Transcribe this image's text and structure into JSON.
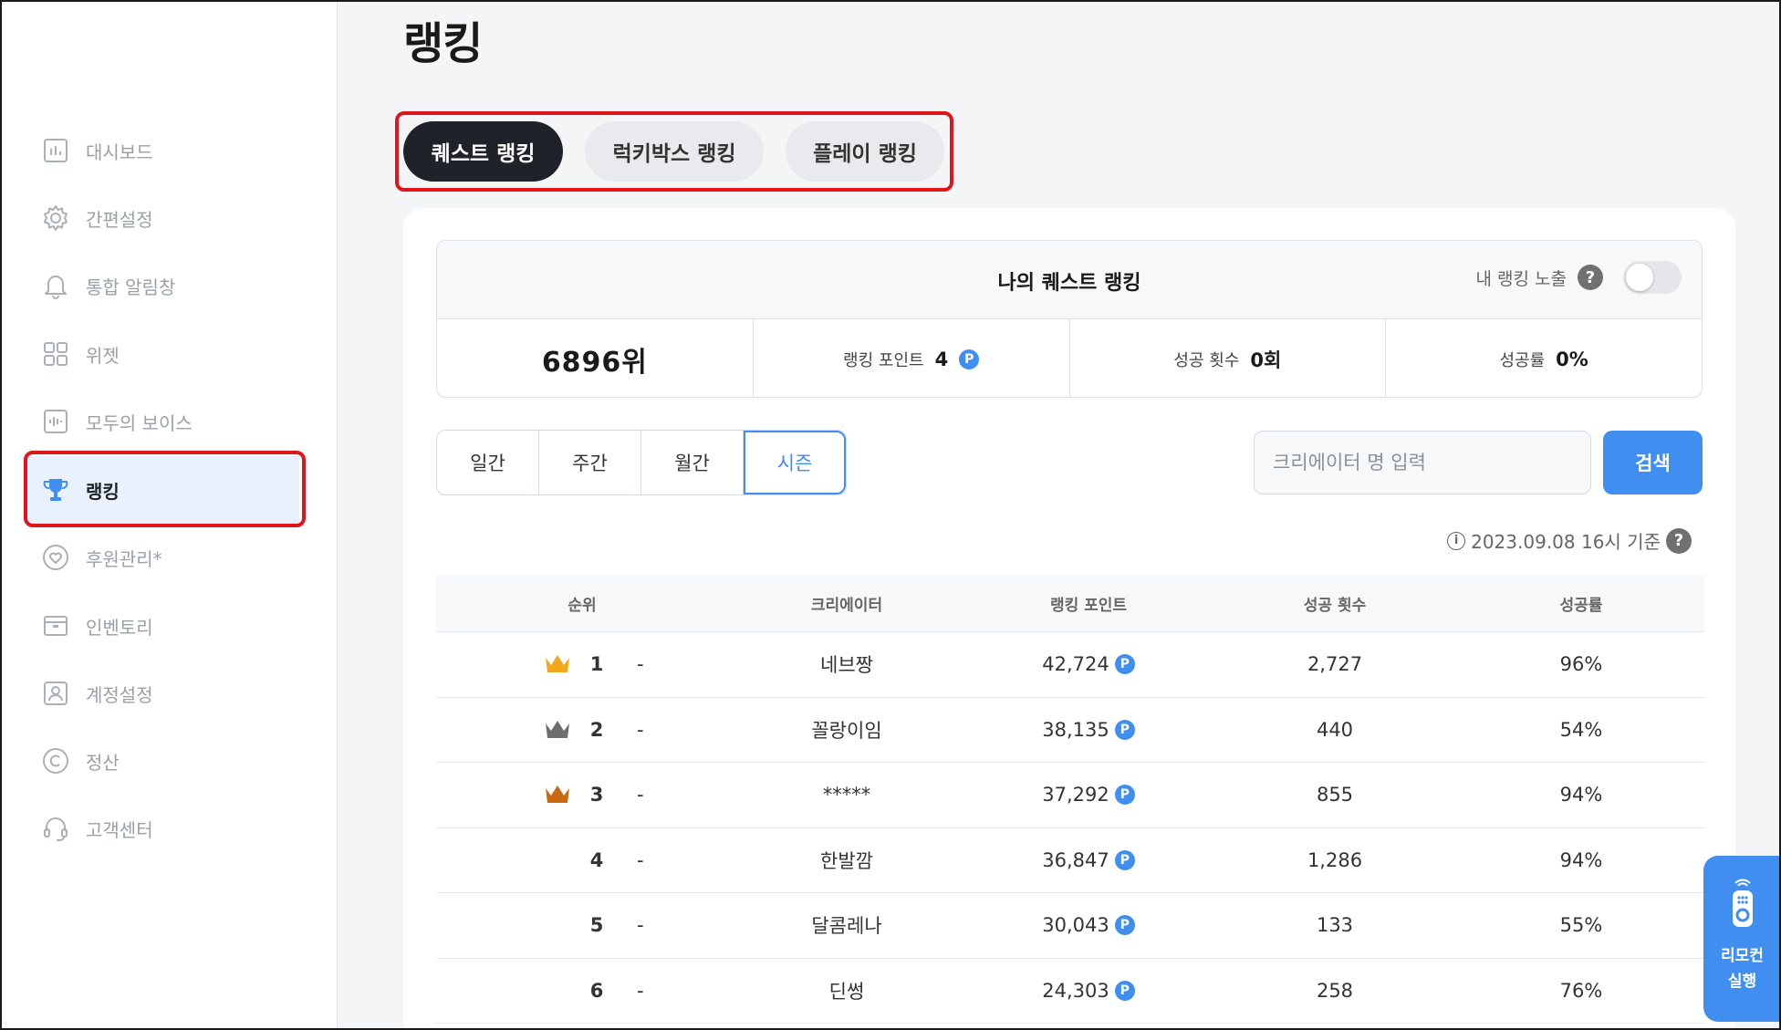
{
  "page": {
    "title": "랭킹"
  },
  "sidebar": {
    "items": [
      {
        "label": "대시보드",
        "icon": "chart-icon"
      },
      {
        "label": "간편설정",
        "icon": "gear-icon"
      },
      {
        "label": "통합 알림창",
        "icon": "bell-icon"
      },
      {
        "label": "위젯",
        "icon": "grid-icon"
      },
      {
        "label": "모두의 보이스",
        "icon": "voice-icon"
      },
      {
        "label": "랭킹",
        "icon": "trophy-icon",
        "active": true
      },
      {
        "label": "후원관리*",
        "icon": "heart-icon"
      },
      {
        "label": "인벤토리",
        "icon": "box-icon"
      },
      {
        "label": "계정설정",
        "icon": "user-icon"
      },
      {
        "label": "정산",
        "icon": "copyright-icon"
      },
      {
        "label": "고객센터",
        "icon": "headset-icon"
      }
    ]
  },
  "tabs": [
    {
      "label": "퀘스트 랭킹",
      "active": true
    },
    {
      "label": "럭키박스 랭킹",
      "active": false
    },
    {
      "label": "플레이 랭킹",
      "active": false
    }
  ],
  "my_ranking": {
    "title": "나의 퀘스트 랭킹",
    "expose_label": "내 랭킹 노출",
    "expose_help": "?",
    "expose_on": false,
    "rank": "6896위",
    "points_label": "랭킹 포인트",
    "points_value": "4",
    "success_label": "성공 횟수",
    "success_value": "0회",
    "rate_label": "성공률",
    "rate_value": "0%"
  },
  "period_filters": [
    {
      "label": "일간",
      "active": false
    },
    {
      "label": "주간",
      "active": false
    },
    {
      "label": "월간",
      "active": false
    },
    {
      "label": "시즌",
      "active": true
    }
  ],
  "search": {
    "placeholder": "크리에이터 명 입력",
    "button_label": "검색"
  },
  "basis": {
    "text": "2023.09.08 16시 기준",
    "info": "i",
    "help": "?"
  },
  "point_badge": "P",
  "table": {
    "headers": [
      "순위",
      "크리에이터",
      "랭킹 포인트",
      "성공 횟수",
      "성공률"
    ],
    "rows": [
      {
        "rank": "1",
        "delta": "-",
        "crown": "gold",
        "creator": "네브짱",
        "points": "42,724",
        "success": "2,727",
        "rate": "96%"
      },
      {
        "rank": "2",
        "delta": "-",
        "crown": "silver",
        "creator": "꼴랑이임",
        "points": "38,135",
        "success": "440",
        "rate": "54%"
      },
      {
        "rank": "3",
        "delta": "-",
        "crown": "bronze",
        "creator": "*****",
        "points": "37,292",
        "success": "855",
        "rate": "94%"
      },
      {
        "rank": "4",
        "delta": "-",
        "crown": "",
        "creator": "한발깜",
        "points": "36,847",
        "success": "1,286",
        "rate": "94%"
      },
      {
        "rank": "5",
        "delta": "-",
        "crown": "",
        "creator": "달콤레나",
        "points": "30,043",
        "success": "133",
        "rate": "55%"
      },
      {
        "rank": "6",
        "delta": "-",
        "crown": "",
        "creator": "딘썽",
        "points": "24,303",
        "success": "258",
        "rate": "76%"
      }
    ]
  },
  "remote": {
    "line1": "리모컨",
    "line2": "실행"
  },
  "colors": {
    "accent": "#3f8ef0",
    "highlight": "#e0141b",
    "dark_tab": "#1f2329",
    "gold": "#f2a81c",
    "silver": "#6e6e6e",
    "bronze": "#c86a12"
  }
}
